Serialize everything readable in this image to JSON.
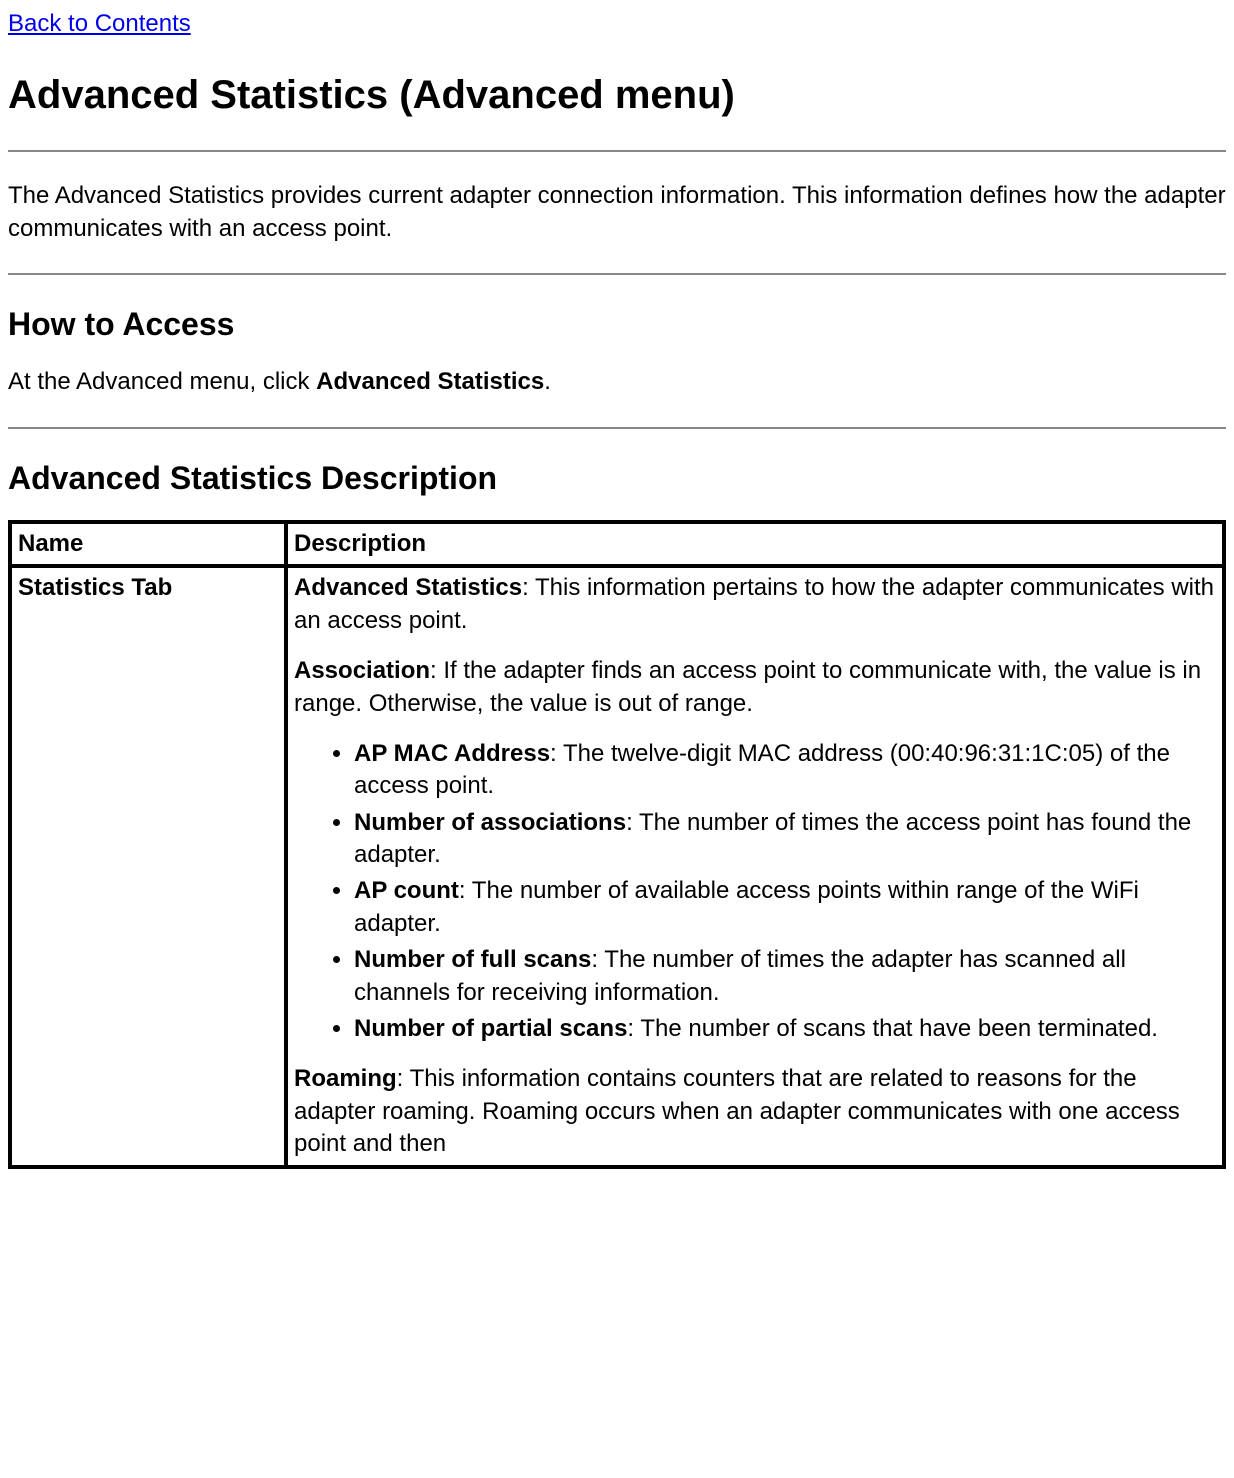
{
  "back_link": "Back to Contents",
  "h1": "Advanced Statistics (Advanced menu)",
  "intro": "The Advanced Statistics provides current adapter connection information. This information defines how the adapter communicates with an access point.",
  "how_to_access": {
    "heading": "How to Access",
    "text_before": "At the Advanced menu, click ",
    "text_bold": "Advanced Statistics",
    "text_after": "."
  },
  "description_heading": "Advanced Statistics Description",
  "table": {
    "header_name": "Name",
    "header_desc": "Description",
    "row1": {
      "name": "Statistics Tab",
      "adv_stats_label": "Advanced Statistics",
      "adv_stats_text": ": This information pertains to how the adapter communicates with an access point.",
      "association_label": "Association",
      "association_text": ": If the adapter finds an access point to communicate with, the value is in range. Otherwise, the value is out of range.",
      "bullets": [
        {
          "label": "AP MAC Address",
          "text": ": The twelve-digit MAC address (00:40:96:31:1C:05) of the access point."
        },
        {
          "label": "Number of associations",
          "text": ": The number of times the access point has found the adapter."
        },
        {
          "label": "AP count",
          "text": ": The number of available access points within range of the WiFi adapter."
        },
        {
          "label": "Number of full scans",
          "text": ": The number of times the adapter has scanned all channels for receiving information."
        },
        {
          "label": "Number of partial scans",
          "text": ": The number of scans that have been terminated."
        }
      ],
      "roaming_label": "Roaming",
      "roaming_text": ": This information contains counters that are related to reasons for the adapter roaming. Roaming occurs when an adapter communicates with one access point and then"
    }
  }
}
